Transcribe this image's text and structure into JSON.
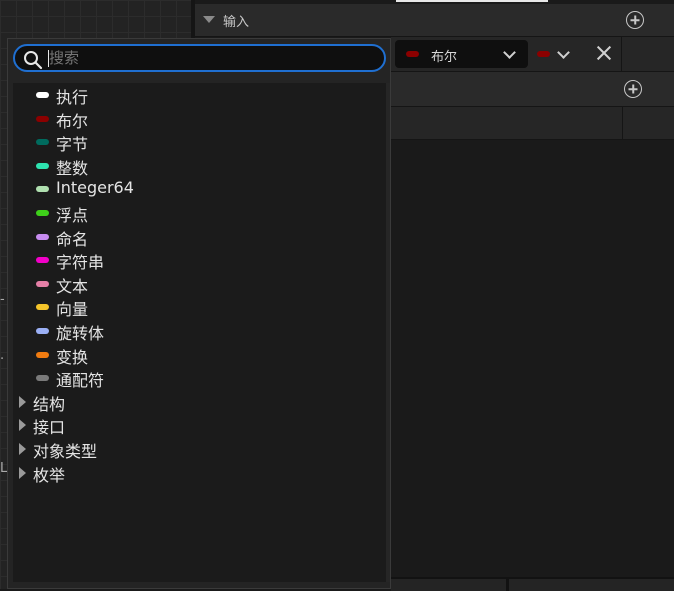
{
  "header": {
    "section_label": "输入"
  },
  "param_row": {
    "type_label": "布尔",
    "type_color": "#8b0000",
    "container_color": "#8b0000"
  },
  "left_glyphs": [
    "-",
    "·",
    "L"
  ],
  "search": {
    "placeholder": "搜索",
    "value": ""
  },
  "types": [
    {
      "label": "执行",
      "color": "#ffffff"
    },
    {
      "label": "布尔",
      "color": "#8b0000"
    },
    {
      "label": "字节",
      "color": "#006b5e"
    },
    {
      "label": "整数",
      "color": "#2ee3b0"
    },
    {
      "label": "Integer64",
      "color": "#b0e0b0"
    },
    {
      "label": "浮点",
      "color": "#3ed01a"
    },
    {
      "label": "命名",
      "color": "#c78cf0"
    },
    {
      "label": "字符串",
      "color": "#f200c8"
    },
    {
      "label": "文本",
      "color": "#e47fa6"
    },
    {
      "label": "向量",
      "color": "#f5c52a"
    },
    {
      "label": "旋转体",
      "color": "#9bb0f5"
    },
    {
      "label": "变换",
      "color": "#f07b10"
    },
    {
      "label": "通配符",
      "color": "#7a7a7a"
    }
  ],
  "categories": [
    {
      "label": "结构"
    },
    {
      "label": "接口"
    },
    {
      "label": "对象类型"
    },
    {
      "label": "枚举"
    }
  ]
}
